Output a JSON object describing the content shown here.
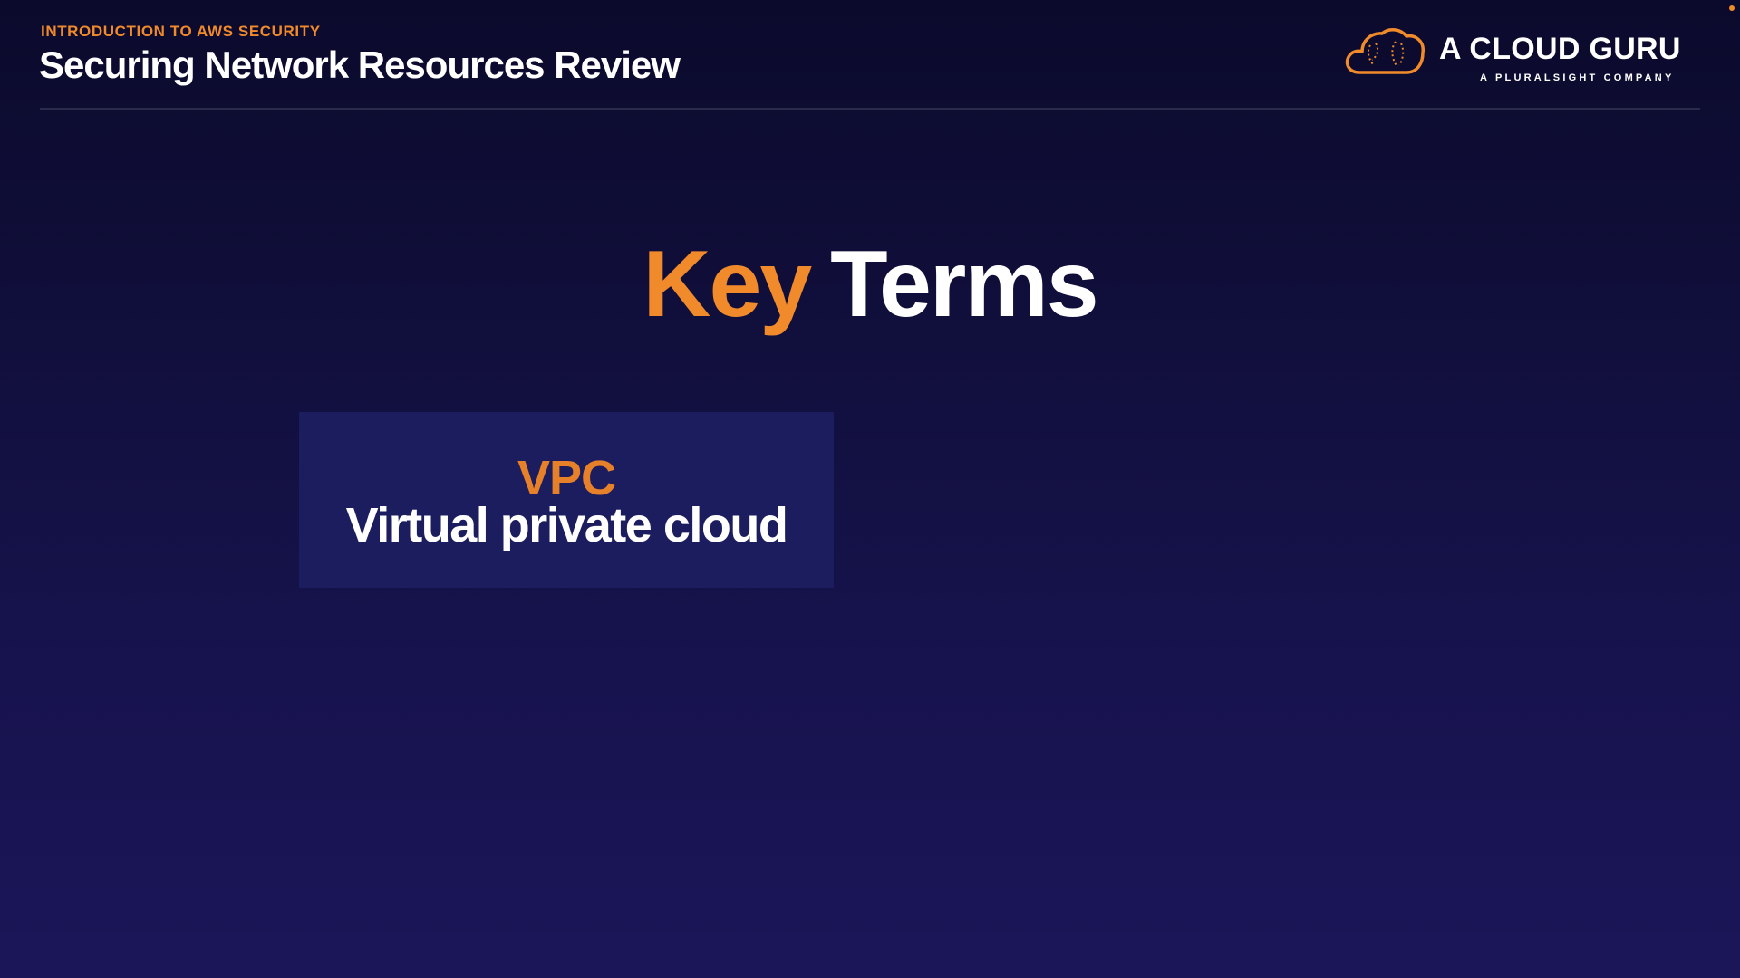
{
  "header": {
    "eyebrow": "INTRODUCTION TO AWS SECURITY",
    "title": "Securing Network Resources Review"
  },
  "logo": {
    "icon": "cloud-guru-icon",
    "wordmark": "A CLOUD GURU",
    "subtitle": "A PLURALSIGHT COMPANY"
  },
  "slide": {
    "heading_accent": "Key",
    "heading_rest": "Terms",
    "terms": [
      {
        "acronym": "VPC",
        "full_name": "Virtual private cloud"
      }
    ]
  },
  "colors": {
    "accent": "#f08a2b",
    "background_top": "#0b0a2c",
    "background_bottom": "#1b1658",
    "card": "#1c1d5e",
    "text": "#ffffff"
  }
}
